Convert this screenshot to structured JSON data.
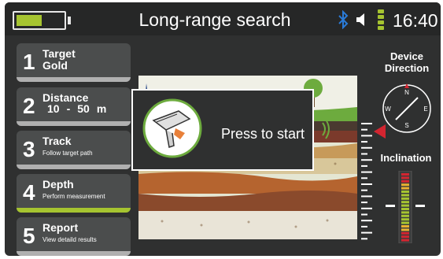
{
  "status_bar": {
    "title": "Long-range search",
    "time": "16:40",
    "battery_level": 0.55,
    "signal_bars": 3
  },
  "menu": [
    {
      "number": "1",
      "title": "Target",
      "subtitle": "Gold"
    },
    {
      "number": "2",
      "title": "Distance",
      "range_min": "10",
      "range_sep": "-",
      "range_max": "50",
      "range_unit": "m"
    },
    {
      "number": "3",
      "title": "Track",
      "subtitle": "Follow target path"
    },
    {
      "number": "4",
      "title": "Depth",
      "subtitle": "Perform measurement",
      "active": true
    },
    {
      "number": "5",
      "title": "Report",
      "subtitle": "View detaild results"
    }
  ],
  "overlay": {
    "prompt": "Press to start"
  },
  "right_panel": {
    "direction_label_line1": "Device",
    "direction_label_line2": "Direction",
    "inclination_label": "Inclination",
    "compass": {
      "n": "N",
      "e": "E",
      "s": "S",
      "w": "W"
    }
  },
  "colors": {
    "accent": "#a6c430",
    "marker": "#d32530",
    "bluetooth": "#2a7bd8"
  }
}
